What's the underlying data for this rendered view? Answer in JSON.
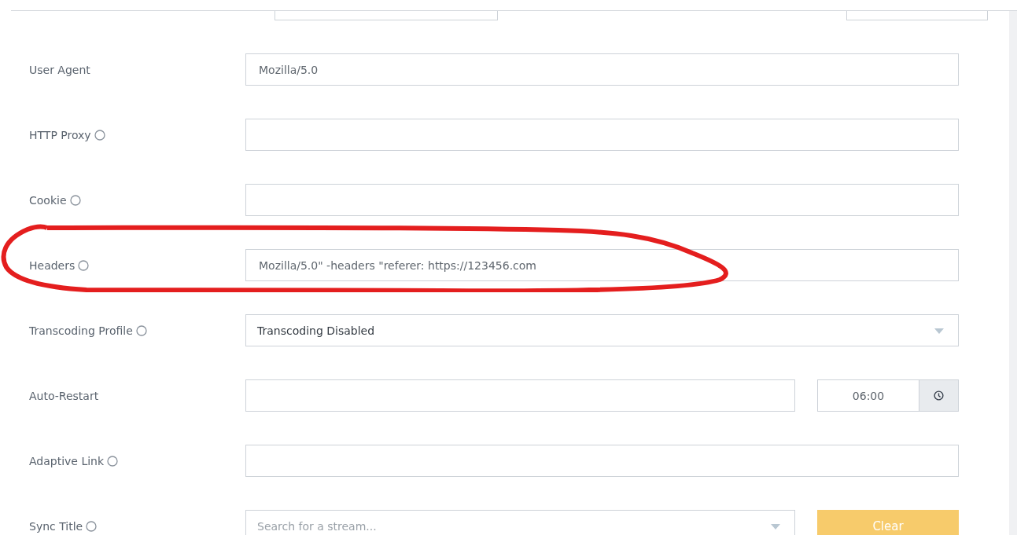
{
  "fields": [
    {
      "label": "User Agent",
      "info": false,
      "kind": "text",
      "value": "Mozilla/5.0"
    },
    {
      "label": "HTTP Proxy",
      "info": true,
      "kind": "text"
    },
    {
      "label": "Cookie",
      "info": true,
      "kind": "text"
    },
    {
      "label": "Headers",
      "info": true,
      "kind": "text",
      "value": "Mozilla/5.0\" -headers \"referer: https://123456.com"
    },
    {
      "label": "Transcoding Profile",
      "info": true,
      "kind": "select",
      "value": "Transcoding Disabled"
    },
    {
      "label": "Auto-Restart",
      "info": false,
      "kind": "time",
      "time": "06:00"
    },
    {
      "label": "Adaptive Link",
      "info": true,
      "kind": "text"
    },
    {
      "label": "Sync Title",
      "info": true,
      "kind": "search",
      "placeholder": "Search for a stream...",
      "button": "Clear"
    }
  ]
}
